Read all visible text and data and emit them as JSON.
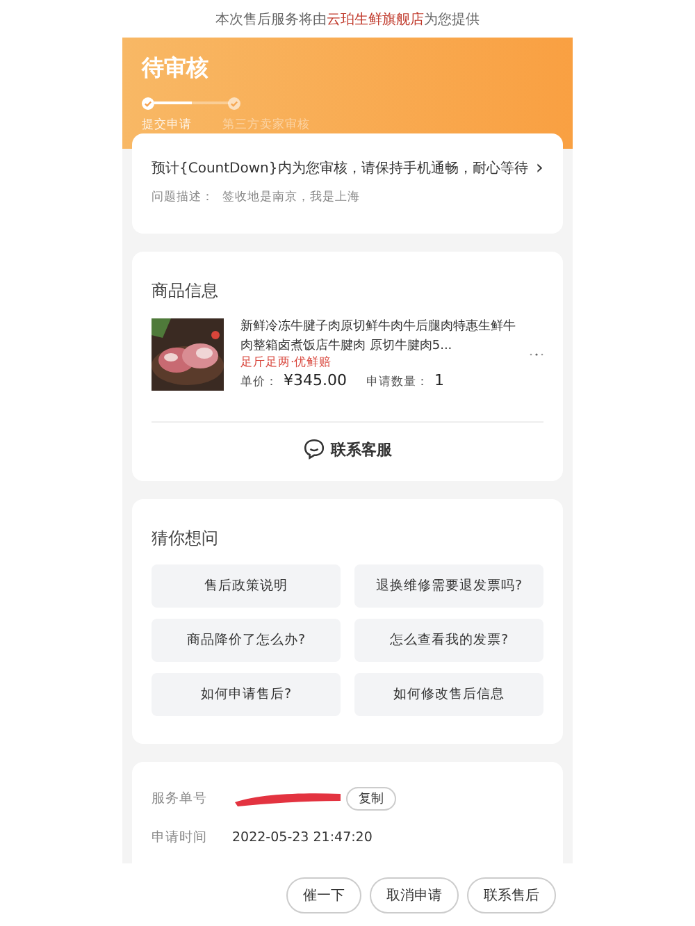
{
  "provider_notice": {
    "before": "本次售后服务将由",
    "store": "云珀生鲜旗舰店",
    "after": "为您提供"
  },
  "header": {
    "title": "待审核",
    "steps": [
      {
        "label": "提交申请",
        "selected": true
      },
      {
        "label": "第三方卖家审核",
        "selected": false
      }
    ]
  },
  "status_card": {
    "message": "预计{CountDown}内为您审核，请保持手机通畅，耐心等待",
    "chevron": "›",
    "description_label": "问题描述：",
    "description": "签收地是南京，我是上海"
  },
  "product_card": {
    "title": "商品信息",
    "product": {
      "kind": "picture",
      "name": "新鲜冷冻牛腱子肉原切鲜牛肉牛后腿肉特惠生鲜牛肉整箱卤煮饭店牛腱肉 原切牛腱肉5...",
      "tag": "足斤足两·优鲜赔",
      "price_label": "单价：",
      "price": "¥345.00",
      "quantity_label": "申请数量：",
      "quantity": "1"
    },
    "contact": "联系客服"
  },
  "faq": {
    "title": "猜你想问",
    "items": [
      "售后政策说明",
      "退换维修需要退发票吗?",
      "商品降价了怎么办?",
      "怎么查看我的发票?",
      "如何申请售后?",
      "如何修改售后信息"
    ]
  },
  "service_info": {
    "rows": [
      {
        "label": "服务单号",
        "kind": "redacted",
        "action": "复制"
      },
      {
        "label": "申请时间",
        "kind": "text",
        "value": "2022-05-23 21:47:20"
      }
    ]
  },
  "actions": [
    "催一下",
    "取消申请",
    "联系售后"
  ]
}
